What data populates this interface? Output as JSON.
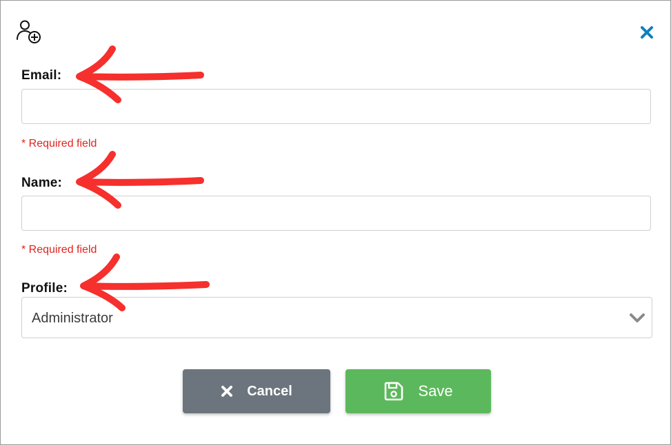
{
  "form": {
    "email": {
      "label": "Email:",
      "value": "",
      "placeholder": "",
      "error": "* Required field"
    },
    "name": {
      "label": "Name:",
      "value": "",
      "placeholder": "",
      "error": "* Required field"
    },
    "profile": {
      "label": "Profile:",
      "selected": "Administrator"
    }
  },
  "buttons": {
    "cancel_label": "Cancel",
    "save_label": "Save"
  },
  "icons": {
    "header": "add-user-icon",
    "close": "close-icon",
    "dropdown": "chevron-down-icon",
    "cancel": "x-icon",
    "save": "floppy-disk-icon",
    "annotation": "red-arrow-annotation"
  },
  "colors": {
    "accent_close": "#0d7fc0",
    "error_text": "#e0231c",
    "cancel_bg": "#6c757d",
    "save_bg": "#5cb85c",
    "annotation_arrow": "#f5302d"
  }
}
